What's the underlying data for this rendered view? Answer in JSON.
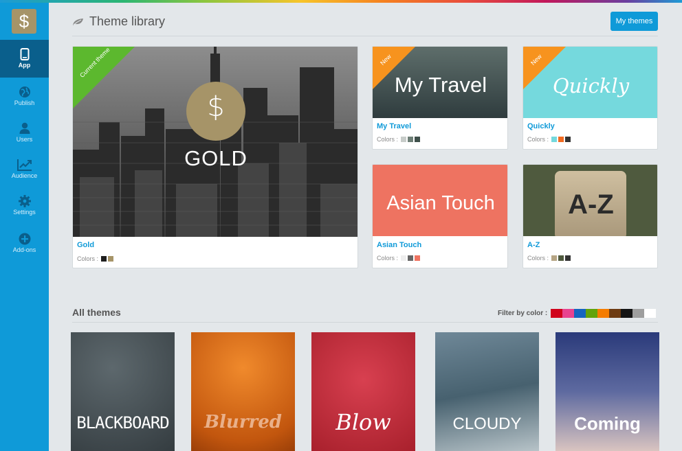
{
  "sidebar": {
    "logo_icon": "dollar-logo-icon",
    "logo_glyph": "$",
    "items": [
      {
        "label": "App",
        "icon": "phone-icon",
        "active": true
      },
      {
        "label": "Publish",
        "icon": "globe-icon"
      },
      {
        "label": "Users",
        "icon": "user-icon"
      },
      {
        "label": "Audience",
        "icon": "chart-icon"
      },
      {
        "label": "Settings",
        "icon": "gear-icon"
      },
      {
        "label": "Add-ons",
        "icon": "plus-circle-icon"
      }
    ]
  },
  "header": {
    "title": "Theme library",
    "title_icon": "leaf-icon",
    "my_themes_label": "My themes"
  },
  "current_theme": {
    "ribbon": "Current theme",
    "thumb_label": "GOLD",
    "thumb_glyph": "$",
    "name": "Gold",
    "colors_label": "Colors :",
    "colors": [
      "#1f1f1f",
      "#a69468"
    ]
  },
  "featured": [
    {
      "ribbon": "New",
      "thumb_label": "My Travel",
      "name": "My Travel",
      "colors_label": "Colors :",
      "colors": [
        "#c7ccc9",
        "#6e7f77",
        "#3e4f4a"
      ]
    },
    {
      "ribbon": "New",
      "thumb_label": "Quickly",
      "name": "Quickly",
      "colors_label": "Colors :",
      "colors": [
        "#75d9dd",
        "#f26b21",
        "#333333"
      ]
    },
    {
      "ribbon": "",
      "thumb_label": "Asian Touch",
      "name": "Asian Touch",
      "colors_label": "Colors :",
      "colors": [
        "#eeeeee",
        "#666666",
        "#ee7361"
      ]
    },
    {
      "ribbon": "",
      "thumb_label": "A-Z",
      "name": "A-Z",
      "colors_label": "Colors :",
      "colors": [
        "#b6a584",
        "#4f5a3e",
        "#333333"
      ]
    }
  ],
  "all_themes": {
    "title": "All themes",
    "filter_label": "Filter by color :",
    "filter_colors": [
      "#d0021b",
      "#e8438f",
      "#1565c0",
      "#62a30a",
      "#f57c00",
      "#6d3b12",
      "#141414",
      "#9e9e9e",
      "#ffffff"
    ],
    "tiles": [
      "BLACKBOARD",
      "Blurred",
      "Blow",
      "CLOUDY",
      "Coming"
    ]
  },
  "colors": {
    "accent": "#0f9ad8",
    "accent_dark": "#0a5f8c",
    "ribbon_current": "#5cb82e",
    "ribbon_new": "#f7931e",
    "gold": "#a69468"
  }
}
